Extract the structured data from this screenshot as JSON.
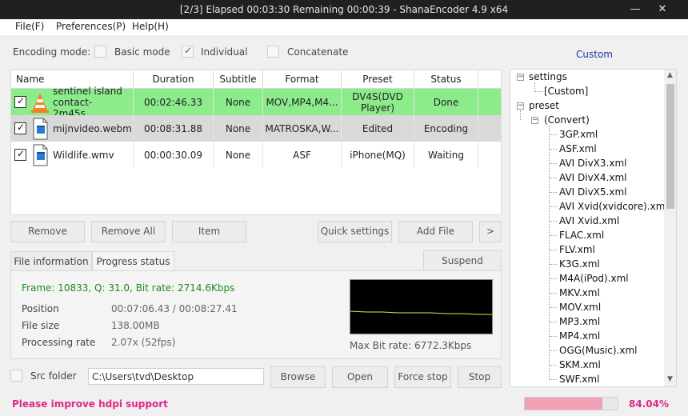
{
  "window": {
    "title": "[2/3] Elapsed 00:03:30  Remaining 00:00:39 - ShanaEncoder 4.9 x64",
    "minimize_glyph": "—",
    "close_glyph": "✕"
  },
  "menu": {
    "file": "File(F)",
    "preferences": "Preferences(P)",
    "help": "Help(H)"
  },
  "encoding": {
    "label": "Encoding mode:",
    "basic": "Basic mode",
    "individual": "Individual",
    "concatenate": "Concatenate",
    "basic_checked": false,
    "individual_checked": true,
    "concatenate_checked": false
  },
  "custom_label": "Custom",
  "table": {
    "headers": [
      "Name",
      "Duration",
      "Subtitle",
      "Format",
      "Preset",
      "Status"
    ],
    "rows": [
      {
        "checked": true,
        "icon": "vlc-cone-icon",
        "name": "sentinel island contact-2m45s....",
        "duration": "00:02:46.33",
        "subtitle": "None",
        "format": "MOV,MP4,M4...",
        "preset": "DV4S(DVD Player)",
        "status": "Done",
        "bg": "#8cec8c"
      },
      {
        "checked": true,
        "icon": "video-file-icon",
        "name": "mijnvideo.webm",
        "duration": "00:08:31.88",
        "subtitle": "None",
        "format": "MATROSKA,W...",
        "preset": "Edited",
        "status": "Encoding",
        "bg": "#d9d9d9"
      },
      {
        "checked": true,
        "icon": "video-file-icon",
        "name": "Wildlife.wmv",
        "duration": "00:00:30.09",
        "subtitle": "None",
        "format": "ASF",
        "preset": "iPhone(MQ)",
        "status": "Waiting",
        "bg": "#ffffff"
      }
    ]
  },
  "buttons": {
    "remove": "Remove",
    "remove_all": "Remove All",
    "item": "Item",
    "quick_settings": "Quick settings",
    "add_file": "Add File",
    "more": ">",
    "suspend": "Suspend",
    "browse": "Browse",
    "open": "Open",
    "force_stop": "Force stop",
    "stop": "Stop"
  },
  "tabs": {
    "file_info": "File information",
    "progress": "Progress status"
  },
  "progress": {
    "frame_line": "Frame: 10833, Q: 31.0, Bit rate: 2714.6Kbps",
    "position_label": "Position",
    "position_value": "00:07:06.43 / 00:08:27.41",
    "filesize_label": "File size",
    "filesize_value": "138.00MB",
    "rate_label": "Processing rate",
    "rate_value": "2.07x (52fps)",
    "max_bitrate": "Max Bit rate: 6772.3Kbps"
  },
  "src_folder": {
    "label": "Src folder",
    "checked": false,
    "path": "C:\\Users\\tvd\\Desktop"
  },
  "tree": {
    "settings": "settings",
    "custom": "[Custom]",
    "preset": "preset",
    "convert": "(Convert)",
    "items": [
      "3GP.xml",
      "ASF.xml",
      "AVI DivX3.xml",
      "AVI DivX4.xml",
      "AVI DivX5.xml",
      "AVI Xvid(xvidcore).xml",
      "AVI Xvid.xml",
      "FLAC.xml",
      "FLV.xml",
      "K3G.xml",
      "M4A(iPod).xml",
      "MKV.xml",
      "MOV.xml",
      "MP3.xml",
      "MP4.xml",
      "OGG(Music).xml",
      "SKM.xml",
      "SWF.xml"
    ]
  },
  "status": {
    "message": "Please improve hdpi support",
    "percent_text": "84.04%",
    "percent": 84.04,
    "accent": "#e0268a"
  }
}
